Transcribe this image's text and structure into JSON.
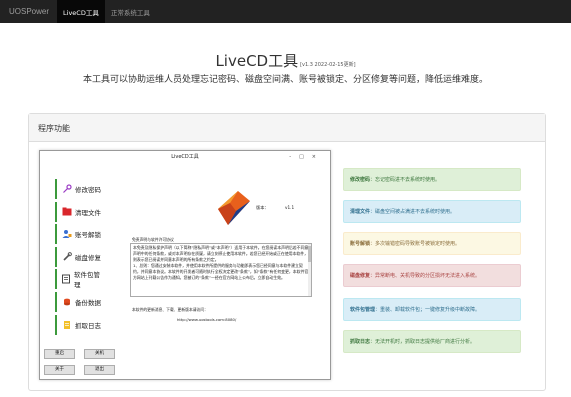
{
  "nav": {
    "brand": "UOSPower",
    "links": [
      "LiveCD工具",
      "正常系统工具"
    ]
  },
  "header": {
    "title": "LiveCD工具",
    "version": "[v1.3 2022-02-15更新]",
    "subtitle": "本工具可以协助运维人员处理忘记密码、磁盘空间满、账号被锁定、分区修复等问题，降低运维难度。"
  },
  "panel": {
    "heading": "程序功能"
  },
  "app_window": {
    "title": "LiveCD工具",
    "window_buttons": [
      "-",
      "□",
      "×"
    ],
    "menu": [
      {
        "label": "修改密码",
        "icon": "key-icon"
      },
      {
        "label": "清理文件",
        "icon": "folder-icon"
      },
      {
        "label": "账号解锁",
        "icon": "user-unlock-icon"
      },
      {
        "label": "磁盘修复",
        "icon": "wrench-icon"
      },
      {
        "label": "软件包管理",
        "icon": "package-icon"
      },
      {
        "label": "备份数据",
        "icon": "backup-icon"
      },
      {
        "label": "抓取日志",
        "icon": "log-icon"
      }
    ],
    "buttons": [
      "重启",
      "关机",
      "关于",
      "退出"
    ],
    "version_label": "版本：",
    "version_value": "v1.1",
    "license_label": "免责声明与软件许可协议",
    "license_text": [
      "本免责及隐私保护声明（以下简称“隐私声明”或“本声明”）适用于本软件。在您阅读本声明后若不同意声明中的任何条款，或对本声明存在质疑，请立刻停止使用本软件。若您已经开始或正在使用本软件，则表示您已阅读并同意本声明的所有条款之约定。",
      "1、总则：您通过安装本软件，并使用本软件所提供的服务与功能即表示您已经同意与本软件建立契约，并同意本协议。本软件的开发者可随时执行全权决定更改“条款”，如“条款”有任何变更，本软件官方网站上刊载公告作为通知。您被订的“条款”一经在官方网站上公布后，立即自动生效。"
    ],
    "homepage_label": "本软件的更新消息、下载、更新版本请访问：",
    "homepage_url": "http://www.uostools.com:8080/"
  },
  "features": [
    {
      "name": "修改密码",
      "desc": "忘记密码进不去系统时使用。",
      "style": "green"
    },
    {
      "name": "清理文件",
      "desc": "磁盘空间被占满进不去系统时使用。",
      "style": "blue"
    },
    {
      "name": "账号解锁",
      "desc": "多次输错密码导致账号被锁定时使用。",
      "style": "yellow"
    },
    {
      "name": "磁盘修复",
      "desc": "异常断电、关机导致的分区损坏无法进入系统。",
      "style": "red"
    },
    {
      "name": "软件包管理",
      "desc": "重装、卸载软件包；一键修复升级中断故障。",
      "style": "blue"
    },
    {
      "name": "抓取日志",
      "desc": "无法开机时，抓取日志提供给厂商进行分析。",
      "style": "green"
    }
  ]
}
